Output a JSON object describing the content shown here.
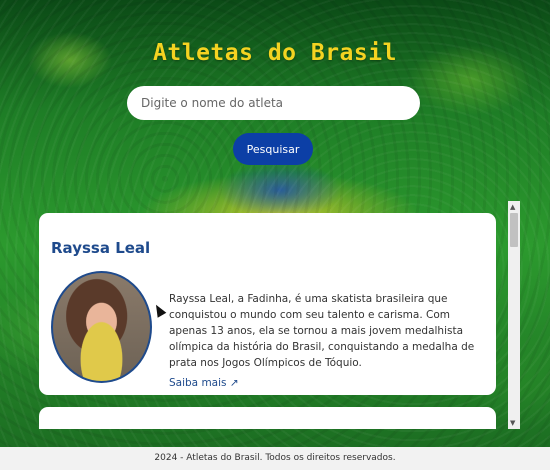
{
  "header": {
    "title": "Atletas do Brasil"
  },
  "search": {
    "placeholder": "Digite o nome do atleta",
    "value": ""
  },
  "actions": {
    "search_button": "Pesquisar"
  },
  "athletes": [
    {
      "name": "Rayssa Leal",
      "bio": "Rayssa Leal, a Fadinha, é uma skatista brasileira que conquistou o mundo com seu talento e carisma. Com apenas 13 anos, ela se tornou a mais jovem medalhista olímpica da história do Brasil, conquistando a medalha de prata nos Jogos Olímpicos de Tóquio.",
      "more_label": "Saiba mais ↗"
    }
  ],
  "footer": {
    "text": "2024 - Atletas do Brasil. Todos os direitos reservados."
  },
  "colors": {
    "title": "#f4d321",
    "button": "#0c3fa6",
    "accent": "#1e4a8c"
  },
  "icons": {
    "scroll_up": "arrow-up-icon",
    "scroll_down": "arrow-down-icon",
    "external": "external-link-icon"
  }
}
